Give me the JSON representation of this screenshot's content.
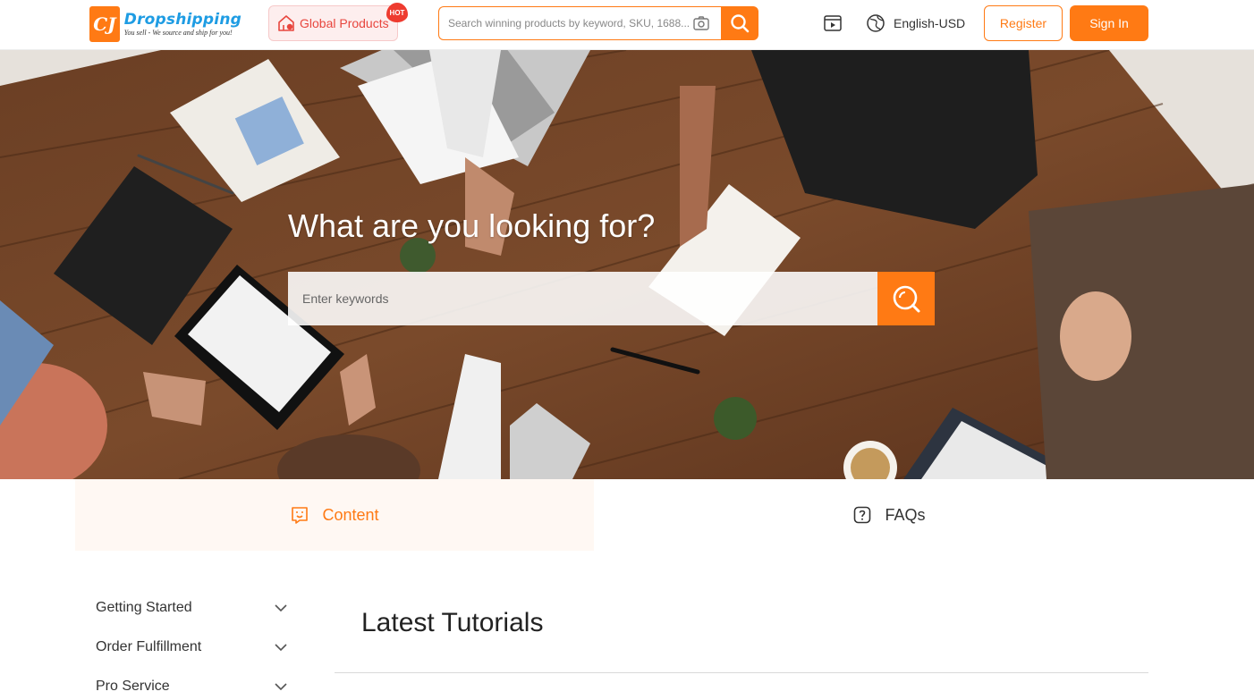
{
  "header": {
    "logo_mark": "CJ",
    "logo_title": "Dropshipping",
    "logo_tagline": "You sell - We source and ship for you!",
    "global_products_label": "Global Products",
    "hot_badge": "HOT",
    "search_placeholder": "Search winning products by keyword, SKU, 1688...",
    "language_label": "English-USD",
    "register_label": "Register",
    "signin_label": "Sign In",
    "icons": [
      "store-icon",
      "camera-icon",
      "search-icon",
      "video-icon",
      "globe-icon"
    ]
  },
  "hero": {
    "title": "What are you looking for?",
    "search_placeholder": "Enter keywords"
  },
  "tabs": [
    {
      "label": "Content",
      "icon": "content-icon",
      "active": true
    },
    {
      "label": "FAQs",
      "icon": "question-icon",
      "active": false
    }
  ],
  "sidebar": {
    "items": [
      {
        "label": "Getting Started"
      },
      {
        "label": "Order Fulfillment"
      },
      {
        "label": "Pro Service"
      }
    ]
  },
  "main": {
    "title": "Latest Tutorials"
  },
  "colors": {
    "accent": "#ff7a14",
    "brand_blue": "#1e9ce3",
    "hot_red": "#ee3b2f",
    "active_tab_bg": "#fff8f3"
  }
}
